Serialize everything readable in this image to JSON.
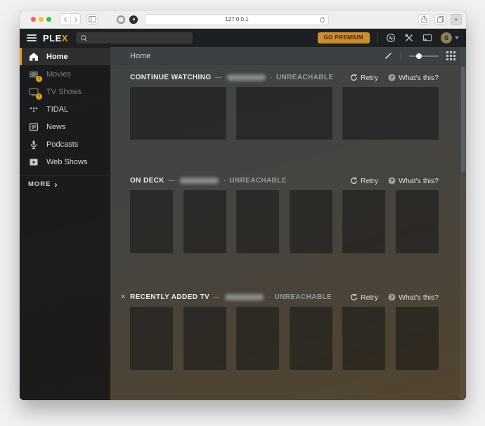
{
  "browser": {
    "url": "127.0.0.1",
    "new_tab_label": "+"
  },
  "plex_header": {
    "logo_text": "PLE",
    "logo_accent": "X",
    "search_placeholder": "",
    "go_premium_label": "GO PREMIUM",
    "avatar_initial": "S"
  },
  "sidebar": {
    "items": [
      {
        "label": "Home",
        "icon": "home-icon",
        "active": true,
        "dimmed": false,
        "warning": false
      },
      {
        "label": "Movies",
        "icon": "movies-icon",
        "active": false,
        "dimmed": true,
        "warning": true
      },
      {
        "label": "TV Shows",
        "icon": "tv-icon",
        "active": false,
        "dimmed": true,
        "warning": true
      },
      {
        "label": "TIDAL",
        "icon": "tidal-icon",
        "active": false,
        "dimmed": false,
        "warning": false
      },
      {
        "label": "News",
        "icon": "news-icon",
        "active": false,
        "dimmed": false,
        "warning": false
      },
      {
        "label": "Podcasts",
        "icon": "podcasts-icon",
        "active": false,
        "dimmed": false,
        "warning": false
      },
      {
        "label": "Web Shows",
        "icon": "web-shows-icon",
        "active": false,
        "dimmed": false,
        "warning": false
      }
    ],
    "warning_badge_glyph": "!",
    "more_label": "MORE",
    "more_chevron": "›"
  },
  "toolbar": {
    "breadcrumb": "Home"
  },
  "sections": [
    {
      "title": "CONTINUE WATCHING",
      "dash": "—",
      "server_name_redacted": true,
      "dot": "·",
      "status": "UNREACHABLE",
      "retry_label": "Retry",
      "whats_this_label": "What's this?",
      "dismissible": false,
      "dismiss_glyph": "×",
      "cards": {
        "type": "landscape",
        "count": 3
      }
    },
    {
      "title": "ON DECK",
      "dash": "—",
      "server_name_redacted": true,
      "dot": "·",
      "status": "UNREACHABLE",
      "retry_label": "Retry",
      "whats_this_label": "What's this?",
      "dismissible": false,
      "dismiss_glyph": "×",
      "cards": {
        "type": "portrait",
        "count": 6
      }
    },
    {
      "title": "RECENTLY ADDED TV",
      "dash": "—",
      "server_name_redacted": true,
      "dot": "·",
      "status": "UNREACHABLE",
      "retry_label": "Retry",
      "whats_this_label": "What's this?",
      "dismissible": true,
      "dismiss_glyph": "×",
      "cards": {
        "type": "portrait",
        "count": 6
      }
    }
  ],
  "colors": {
    "accent_gold": "#e5a00d",
    "premium_button": "#cf8c2b",
    "header_bg": "#1d2022",
    "content_top": "#3e4345",
    "content_bottom": "#52452f"
  }
}
